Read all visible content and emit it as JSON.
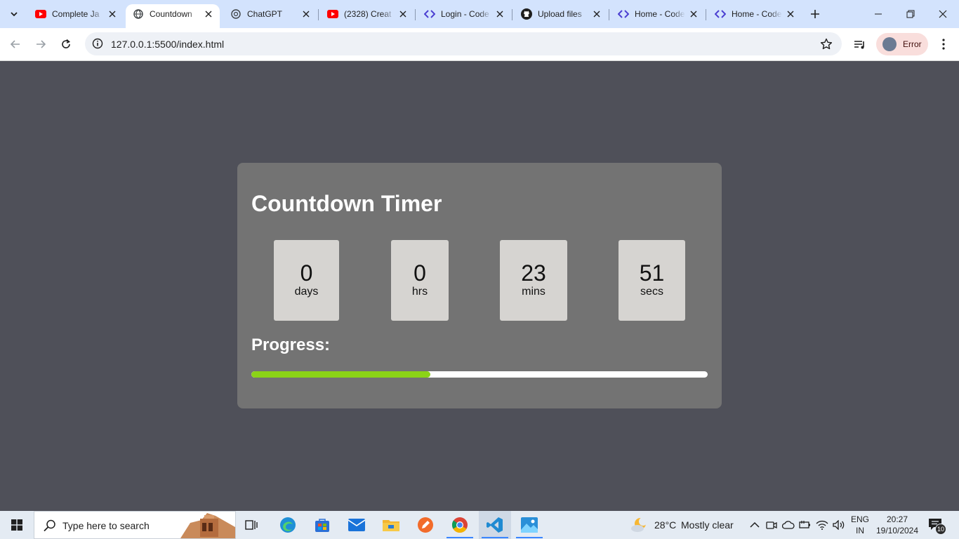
{
  "browser": {
    "tabs": [
      {
        "title": "Complete Ja",
        "favicon": "youtube-icon"
      },
      {
        "title": "Countdown",
        "favicon": "globe-icon",
        "active": true
      },
      {
        "title": "ChatGPT",
        "favicon": "chatgpt-icon"
      },
      {
        "title": "(2328) Creat",
        "favicon": "youtube-icon"
      },
      {
        "title": "Login - Code",
        "favicon": "code-icon"
      },
      {
        "title": "Upload files",
        "favicon": "github-icon"
      },
      {
        "title": "Home - Code",
        "favicon": "code-icon"
      },
      {
        "title": "Home - Code",
        "favicon": "code-icon"
      }
    ],
    "url": "127.0.0.1:5500/index.html",
    "profile_label": "Error"
  },
  "page": {
    "title": "Countdown Timer",
    "units": [
      {
        "value": "0",
        "label": "days"
      },
      {
        "value": "0",
        "label": "hrs"
      },
      {
        "value": "23",
        "label": "mins"
      },
      {
        "value": "51",
        "label": "secs"
      }
    ],
    "progress_label": "Progress:",
    "progress_fraction": 0.393,
    "colors": {
      "background": "#4f5059",
      "card": "#737373",
      "unit_box": "#d6d4d1",
      "progress_fill": "#8bd317",
      "progress_track": "#ffffff"
    }
  },
  "taskbar": {
    "search_placeholder": "Type here to search",
    "weather": {
      "temp": "28°C",
      "desc": "Mostly clear"
    },
    "lang": {
      "line1": "ENG",
      "line2": "IN"
    },
    "clock": {
      "time": "20:27",
      "date": "19/10/2024"
    },
    "notification_count": "10"
  }
}
